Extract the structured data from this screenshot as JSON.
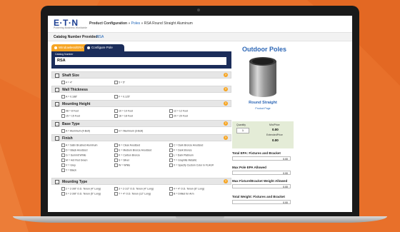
{
  "header": {
    "logo": "E·T·N",
    "logo_tagline": "Powering Business Worldwide",
    "crumb_root": "Product Configuration",
    "crumb_sep1": "»",
    "crumb_poles": "Poles",
    "crumb_sep2": "»",
    "crumb_current": "RSA Round Straight Aluminum"
  },
  "catalog_bar": {
    "label": "Catalog Number Provided:",
    "value": "RSA"
  },
  "tabs": [
    {
      "label": "Windowless/ERA"
    },
    {
      "label": "Configure Pole"
    }
  ],
  "catalog_panel": {
    "label": "Catalog Number",
    "value": "RSA"
  },
  "sections": [
    {
      "title": "Shaft Size",
      "options": [
        "4 = 4\"",
        "5 = 5\""
      ]
    },
    {
      "title": "Wall Thickness",
      "options": [
        "A = 0.188\"",
        "F = 0.125\""
      ]
    },
    {
      "title": "Mounting Height",
      "options": [
        "08 = 8 Foot",
        "10 = 10 Foot",
        "12 = 12 Foot",
        "15 = 15 Foot",
        "18 = 18 Foot",
        "20 = 20 Foot"
      ]
    },
    {
      "title": "Base Type",
      "options": [
        "A = Aluminum (4-Bolt)",
        "H = Aluminum (3-Bolt)"
      ]
    },
    {
      "title": "Finish",
      "options": [
        "A = Satin Brushed Aluminum",
        "B = Clear Anodized",
        "C = Dark Bronze Anodized",
        "D = Black Anodized",
        "E = Medium Bronze Anodized",
        "F = Dark Bronze",
        "G = Summit White",
        "K = Carbon Bronze",
        "L = Dark Platinum",
        "M = Hot Rod Green",
        "S = Silver",
        "T = Graphite Metallic",
        "V = Grey",
        "W = White",
        "X = Specify Custom Color in FLAG#",
        "Y = Black"
      ]
    },
    {
      "title": "Mounting Type",
      "options": [
        "2 = 2-3/8\" O.D. Tenon (4\" Long)",
        "3 = 2-1/2\" O.D. Tenon (4\" Long)",
        "4 = 4\" O.D. Tenon (6\" Long)",
        "5 = 2-3/8\" O.D. Tenon (5\" Long)",
        "T = 4\" O.D. Tenon (12\" Long)",
        "B = Drilled for Arm"
      ]
    }
  ],
  "product": {
    "title": "Outdoor Poles",
    "type": "Round Straight",
    "link": "Product Page"
  },
  "pricing": {
    "qty_label": "Quantity",
    "qty_value": "1",
    "min_label": "Min/Price",
    "min_value": "0.00",
    "ext_label": "ExtendedPrice",
    "ext_value": "0.00"
  },
  "right_fields": [
    {
      "label": "Total EPA: Fixtures and Bracket",
      "value": "0.00"
    },
    {
      "label": "Max Pole EPA Allowed",
      "value": "0.00"
    },
    {
      "label": "Max Fixture/Bracket Weight Allowed",
      "value": "0.00"
    },
    {
      "label": "Total Weight: Fixtures and Bracket",
      "value": "0.00"
    }
  ],
  "colors": {
    "accent": "#f6a524",
    "navy": "#1b2d5a",
    "link": "#2d67b6",
    "background": "#e8702a"
  }
}
